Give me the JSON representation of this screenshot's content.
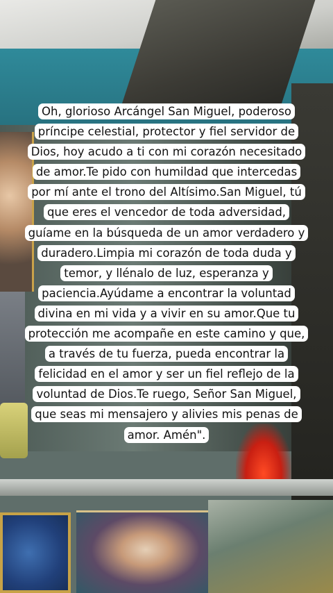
{
  "prayer": {
    "lines": [
      "Oh, glorioso Arcángel San Miguel, poderoso",
      "príncipe celestial, protector y fiel servidor de",
      "Dios, hoy acudo a ti con mi corazón necesitado",
      "de amor.Te pido con humildad que intercedas",
      "por mí ante el trono del Altísimo.San Miguel, tú",
      "que eres el vencedor de toda adversidad,",
      "guíame en la búsqueda de un amor verdadero y",
      "duradero.Limpia mi corazón de toda duda y",
      "temor, y llénalo de luz, esperanza y",
      "paciencia.Ayúdame a encontrar la voluntad",
      "divina en mi vida y a vivir en su amor.Que tu",
      "protección me acompañe en este camino y que,",
      "a través de tu fuerza, pueda encontrar la",
      "felicidad en el amor y ser un fiel reflejo de la",
      "voluntad de Dios.Te ruego, Señor San Miguel,",
      "que seas mi mensajero y alivies mis penas de",
      "amor. Amén\"."
    ]
  }
}
